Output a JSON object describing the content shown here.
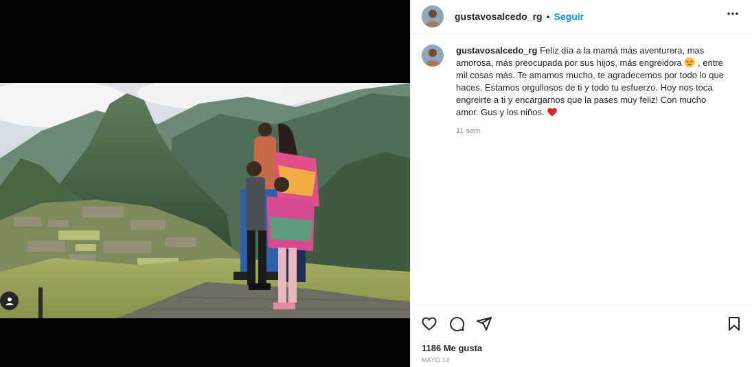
{
  "post": {
    "username": "gustavosalcedo_rg",
    "separator": "•",
    "follow_label": "Seguir",
    "more_icon": "more-horizontal-icon"
  },
  "caption": {
    "username": "gustavosalcedo_rg",
    "text_part1": "Feliz día a la mamá más aventurera, mas amorosa, más preocupada por sus hijos, más engreidora",
    "emoji1": "star-struck-emoji",
    "text_part2": ", entre mil cosas más. Te amamos mucho, te agradecemos por todo lo que haces. Estamos orgullosos de ti y todo tu esfuerzo. Hoy nos toca engreirte a ti y encargarnos que la pases muy feliz! Con mucho amor. Gus y los niños.",
    "emoji2": "red-heart-emoji",
    "time": "11 sem"
  },
  "actions": {
    "icons": [
      "heart-icon",
      "comment-icon",
      "share-icon",
      "bookmark-icon"
    ]
  },
  "likes": "1186 Me gusta",
  "date": "MAYO 14",
  "colors": {
    "accent": "#0095f6",
    "muted": "#8e8e8e",
    "text": "#262626"
  }
}
